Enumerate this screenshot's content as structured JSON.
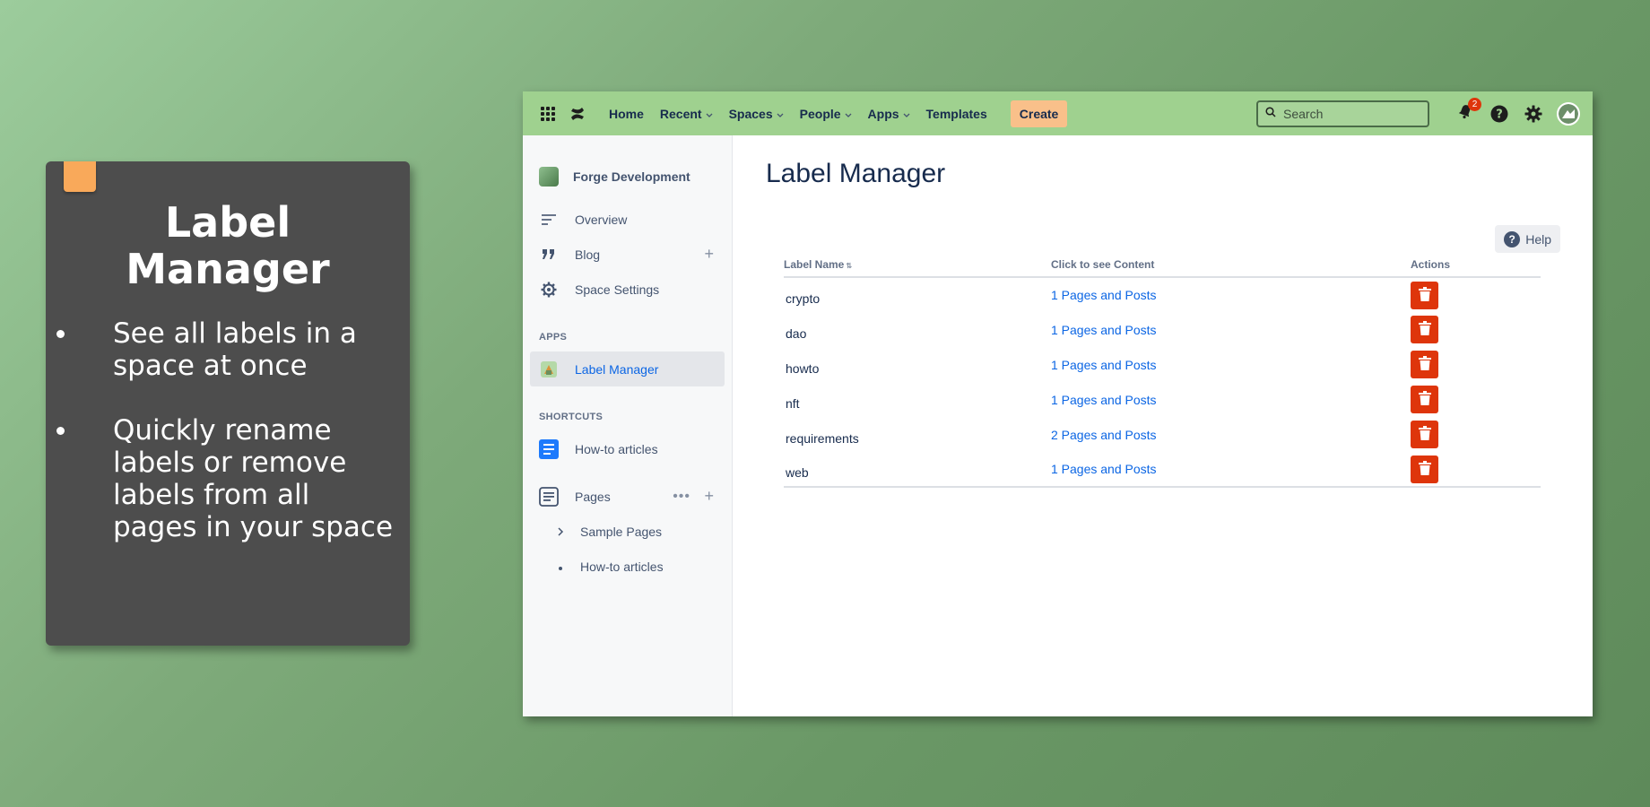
{
  "promo": {
    "title": "Label Manager",
    "bullets": [
      "See all labels in a space at once",
      "Quickly rename labels or remove labels from all pages in your space"
    ]
  },
  "topbar": {
    "nav": {
      "home": "Home",
      "recent": "Recent",
      "spaces": "Spaces",
      "people": "People",
      "apps": "Apps",
      "templates": "Templates"
    },
    "create_label": "Create",
    "search_placeholder": "Search",
    "notification_count": "2"
  },
  "sidebar": {
    "space_name": "Forge Development",
    "items": {
      "overview": "Overview",
      "blog": "Blog",
      "space_settings": "Space Settings"
    },
    "apps_label": "APPS",
    "apps_item": "Label Manager",
    "shortcuts_label": "SHORTCUTS",
    "shortcut_item": "How-to articles",
    "pages_label": "Pages",
    "page_children": [
      "Sample Pages",
      "How-to articles"
    ]
  },
  "main": {
    "title": "Label Manager",
    "help_label": "Help",
    "table": {
      "headers": [
        "Label Name",
        "Click to see Content",
        "Actions"
      ],
      "rows": [
        {
          "label": "crypto",
          "content": "1 Pages and Posts"
        },
        {
          "label": "dao",
          "content": "1 Pages and Posts"
        },
        {
          "label": "howto",
          "content": "1 Pages and Posts"
        },
        {
          "label": "nft",
          "content": "1 Pages and Posts"
        },
        {
          "label": "requirements",
          "content": "2 Pages and Posts"
        },
        {
          "label": "web",
          "content": "1 Pages and Posts"
        }
      ]
    }
  },
  "colors": {
    "topbar": "#9fd18f",
    "create_button": "#f9c08a",
    "delete_button": "#de350b",
    "link": "#0c66e4",
    "promo_card": "#4d4d4d",
    "ribbon": "#f9a95a"
  }
}
